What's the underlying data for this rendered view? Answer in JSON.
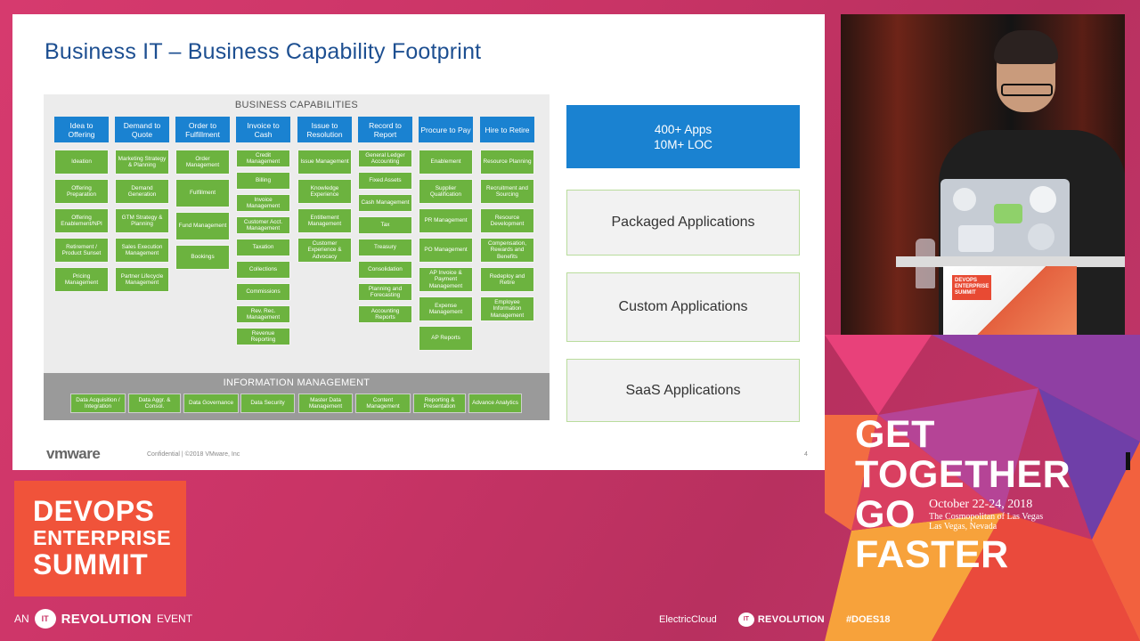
{
  "slide": {
    "title": "Business IT – Business Capability Footprint",
    "capabilities_heading": "BUSINESS CAPABILITIES",
    "columns": [
      {
        "head": "Idea to Offering",
        "cells": [
          "Ideation",
          "Offering Preparation",
          "Offering Enablement/NPI",
          "Retirement / Product Sunset",
          "Pricing Management"
        ]
      },
      {
        "head": "Demand to Quote",
        "cells": [
          "Marketing Strategy & Planning",
          "Demand Generation",
          "GTM Strategy & Planning",
          "Sales Execution Management",
          "Partner Lifecycle Management"
        ]
      },
      {
        "head": "Order to Fulfillment",
        "cells": [
          "Order Management",
          "Fulfillment",
          "Fund Management",
          "Bookings"
        ]
      },
      {
        "head": "Invoice to Cash",
        "cells": [
          "Credit Management",
          "Billing",
          "Invoice Management",
          "Customer Acct. Management",
          "Taxation",
          "Collections",
          "Commissions",
          "Rev. Rec. Management",
          "Revenue Reporting"
        ]
      },
      {
        "head": "Issue to Resolution",
        "cells": [
          "Issue Management",
          "Knowledge Experience",
          "Entitlement Management",
          "Customer Experience & Advocacy"
        ]
      },
      {
        "head": "Record to Report",
        "cells": [
          "General Ledger Accounting",
          "Fixed Assets",
          "Cash Management",
          "Tax",
          "Treasury",
          "Consolidation",
          "Planning and Forecasting",
          "Accounting Reports"
        ]
      },
      {
        "head": "Procure to Pay",
        "cells": [
          "Enablement",
          "Supplier Qualification",
          "PR Management",
          "PO Management",
          "AP Invoice & Payment Management",
          "Expense Management",
          "AP Reports"
        ]
      },
      {
        "head": "Hire to Retire",
        "cells": [
          "Resource Planning",
          "Recruitment and Sourcing",
          "Resource Development",
          "Compensation, Rewards and Benefits",
          "Redeploy and Retire",
          "Employee Information Management"
        ]
      }
    ],
    "info_heading": "INFORMATION MANAGEMENT",
    "info_cells": [
      "Data Acquisition / Integration",
      "Data Aggr. & Consol.",
      "Data Governance",
      "Data Security",
      "Master Data Management",
      "Content Management",
      "Reporting & Presentation",
      "Advance Analytics"
    ],
    "apps_line1": "400+ Apps",
    "apps_line2": "10M+ LOC",
    "packaged": "Packaged Applications",
    "custom": "Custom Applications",
    "saas": "SaaS Applications",
    "footer_logo": "vmware",
    "footer_text": "Confidential   |   ©2018 VMware, Inc",
    "page_number": "4"
  },
  "branding": {
    "badge_line1": "DEVOPS",
    "badge_line2": "ENTERPRISE",
    "badge_line3": "SUMMIT",
    "an": "AN",
    "it": "IT",
    "revolution": "REVOLUTION",
    "event": "EVENT",
    "slogan": [
      "GET",
      "TOGETHER",
      "GO",
      "FASTER"
    ],
    "date": "October 22-24, 2018",
    "venue": "The Cosmopolitan of Las Vegas",
    "city": "Las Vegas, Nevada",
    "sponsor1": "ElectricCloud",
    "sponsor2": "REVOLUTION",
    "hashtag": "#DOES18",
    "podium_logo": "DEVOPS ENTERPRISE SUMMIT"
  },
  "colors": {
    "background": "#c93466",
    "slide_title": "#1d4f91",
    "capability_header": "#1a82d1",
    "capability_cell": "#6cb33f",
    "info_band": "#9a9a9a",
    "badge": "#f0533a"
  }
}
